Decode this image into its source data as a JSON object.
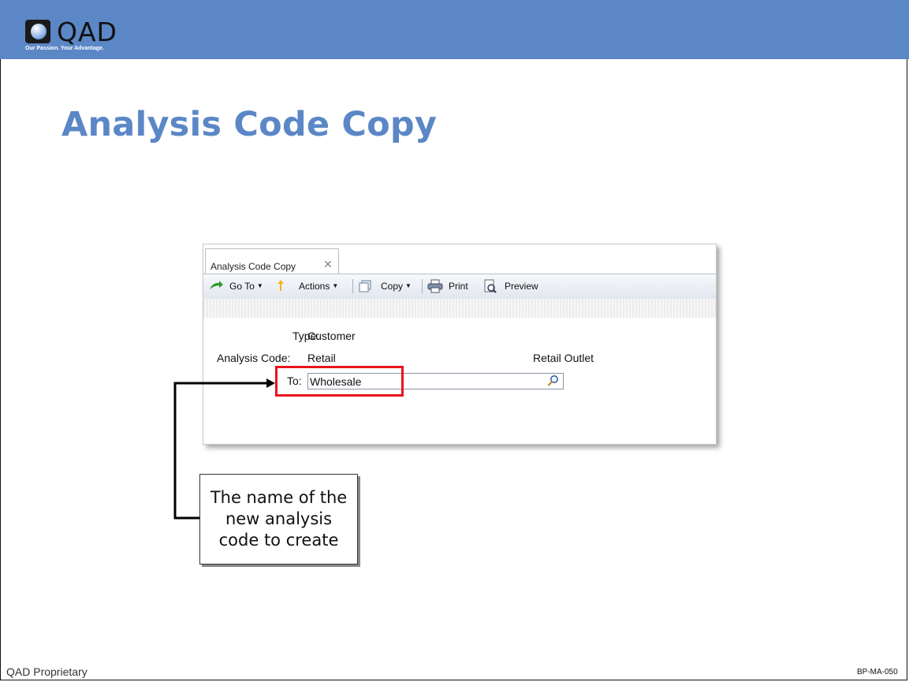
{
  "brand": {
    "name": "QAD",
    "tagline": "Our Passion. Your Advantage.",
    "header_color": "#5b87c6"
  },
  "slide": {
    "title": "Analysis Code Copy",
    "footer_left": "QAD Proprietary",
    "footer_right": "BP-MA-050"
  },
  "window": {
    "tab_label": "Analysis Code Copy",
    "toolbar": {
      "goto": "Go To",
      "actions": "Actions",
      "copy": "Copy",
      "print": "Print",
      "preview": "Preview"
    },
    "form": {
      "type_label": "Type:",
      "type_value": "Customer",
      "code_label": "Analysis Code:",
      "code_value": "Retail",
      "code_description": "Retail Outlet",
      "to_label": "To:",
      "to_value": "Wholesale"
    }
  },
  "callout": {
    "text": "The name of the new analysis code to create"
  },
  "colors": {
    "highlight": "#e8141c",
    "title": "#5b87c6"
  }
}
